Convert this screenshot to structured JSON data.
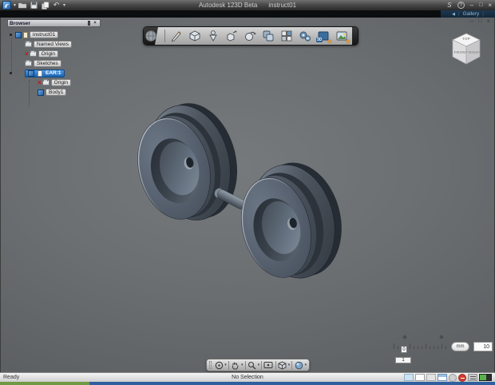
{
  "window": {
    "title_app": "Autodesk 123D Beta",
    "title_doc": "instruct01",
    "signin": "S",
    "help": "?",
    "minimize": "–",
    "restore": "□",
    "close": "×",
    "menu_caret": "▾",
    "undo": "↶"
  },
  "gallery": {
    "arrow": "◀",
    "label": "Gallery",
    "sep": "|"
  },
  "doc_window": {
    "minimize": "–",
    "restore": "□",
    "close": "×"
  },
  "glyphs": {
    "hidden": "×",
    "star": "★",
    "caret": "▾"
  },
  "browser": {
    "header": "Browser",
    "close": "×",
    "items": [
      {
        "label": "instruct01"
      },
      {
        "label": "Named Views"
      },
      {
        "label": "Origin"
      },
      {
        "label": "Sketches"
      },
      {
        "label": "EAR:1"
      },
      {
        "label": "Origin"
      },
      {
        "label": "Body1"
      }
    ]
  },
  "toolbar": {
    "badge_3d": "3D",
    "icons": [
      "main-menu",
      "sketch",
      "primitive-box",
      "revolve",
      "move",
      "pattern",
      "combine",
      "split",
      "gears",
      "insert-3d",
      "insert-image"
    ]
  },
  "viewcube": {
    "top": "TOP",
    "front": "FRONT",
    "right": "RIGHT"
  },
  "navbar": {
    "icons": [
      "orbit",
      "pan",
      "zoom",
      "look-at",
      "display-style",
      "material"
    ]
  },
  "scale_widget": {
    "origin": "0",
    "step": "1",
    "unit": "mm",
    "grid_size": "10"
  },
  "status": {
    "left": "Ready",
    "center": "No Selection"
  }
}
